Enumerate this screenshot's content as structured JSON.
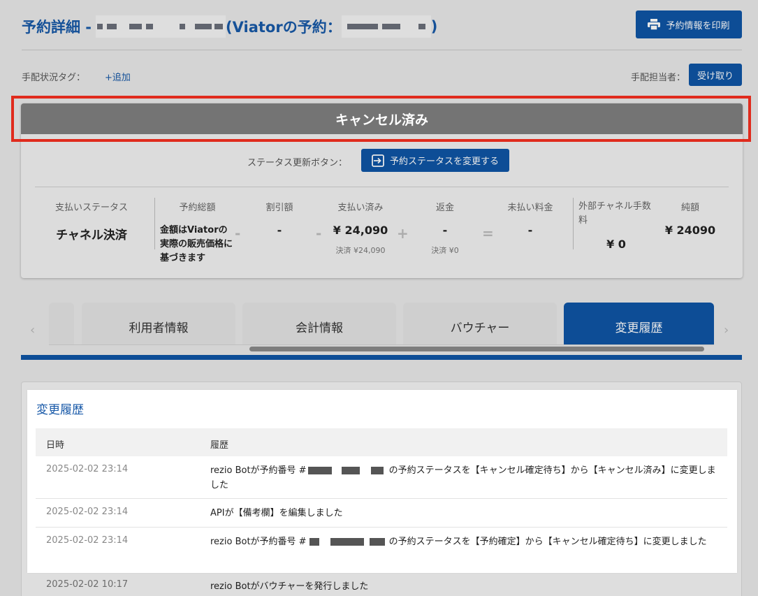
{
  "header": {
    "title_prefix": "予約詳細 -",
    "title_middle": "(Viatorの予約：",
    "title_suffix": ")",
    "print_button": "予約情報を印刷",
    "tag_label": "手配状況タグ：",
    "tag_add": "+追加",
    "assignee_label": "手配担当者：",
    "assignee_button": "受け取り"
  },
  "status": {
    "banner": "キャンセル済み",
    "update_label": "ステータス更新ボタン：",
    "change_button": "予約ステータスを変更する"
  },
  "payment": {
    "payment_status_label": "支払いステータス",
    "payment_status_value": "チャネル決済",
    "total_label": "予約総額",
    "total_value": "金額はViatorの実際の販売価格に基づきます",
    "discount_label": "割引額",
    "discount_value": "-",
    "paid_label": "支払い済み",
    "paid_value": "¥ 24,090",
    "paid_sub": "決済 ¥24,090",
    "refund_label": "返金",
    "refund_value": "-",
    "refund_sub": "決済 ¥0",
    "unpaid_label": "未払い料金",
    "unpaid_value": "-",
    "external_fee_label": "外部チャネル手数料",
    "external_fee_value": "¥ 0",
    "net_label": "純額",
    "net_value": "¥ 24090",
    "op_minus": "-",
    "op_plus": "+",
    "op_equals": "="
  },
  "tabs": [
    {
      "label": "利用者情報"
    },
    {
      "label": "会計情報"
    },
    {
      "label": "バウチャー"
    },
    {
      "label": "変更履歴"
    }
  ],
  "history": {
    "title": "変更履歴",
    "col_datetime": "日時",
    "col_history": "履歴",
    "rows": [
      {
        "date": "2025-02-02 23:14",
        "text_before": "rezio Botが予約番号 #",
        "text_after": "の予約ステータスを【キャンセル確定待ち】から【キャンセル済み】に変更しました"
      },
      {
        "date": "2025-02-02 23:14",
        "text": "APIが【備考欄】を編集しました"
      },
      {
        "date": "2025-02-02 23:14",
        "text_before": "rezio Botが予約番号 #",
        "text_after": "の予約ステータスを【予約確定】から【キャンセル確定待ち】に変更しました"
      },
      {
        "date": "2025-02-02 10:17",
        "text": "rezio Botがバウチャーを発行しました"
      }
    ]
  },
  "icons": {
    "print": "printer-icon",
    "status_change": "enter-icon",
    "tab_prev": "chevron-left-icon",
    "tab_next": "chevron-right-icon"
  },
  "colors": {
    "primary": "#0f55a5",
    "highlight": "#e02b1d",
    "cancel_banner": "#747474"
  }
}
